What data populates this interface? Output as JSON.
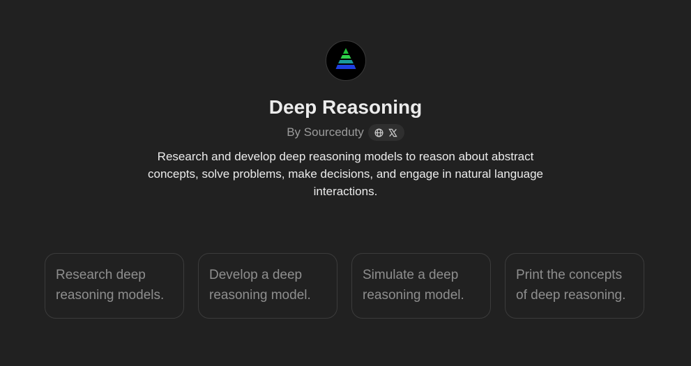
{
  "gpt": {
    "title": "Deep Reasoning",
    "byline": "By Sourceduty",
    "description": "Research and develop deep reasoning models to reason about abstract concepts, solve problems, make decisions, and engage in natural language interactions.",
    "avatar_icon": "pyramid-logo-icon",
    "social_icons": [
      "globe-icon",
      "x-logo-icon"
    ]
  },
  "conversation_starters": [
    {
      "label": "Research deep reasoning models."
    },
    {
      "label": "Develop a deep reasoning model."
    },
    {
      "label": "Simulate a deep reasoning model."
    },
    {
      "label": "Print the concepts of deep reasoning."
    }
  ],
  "colors": {
    "background": "#212121",
    "title": "#ececec",
    "muted": "#9b9b9b",
    "starter_border": "#3c3c3c",
    "logo_green": "#22c43a",
    "logo_teal": "#1a9a9a",
    "logo_blue": "#1f3fe0"
  }
}
